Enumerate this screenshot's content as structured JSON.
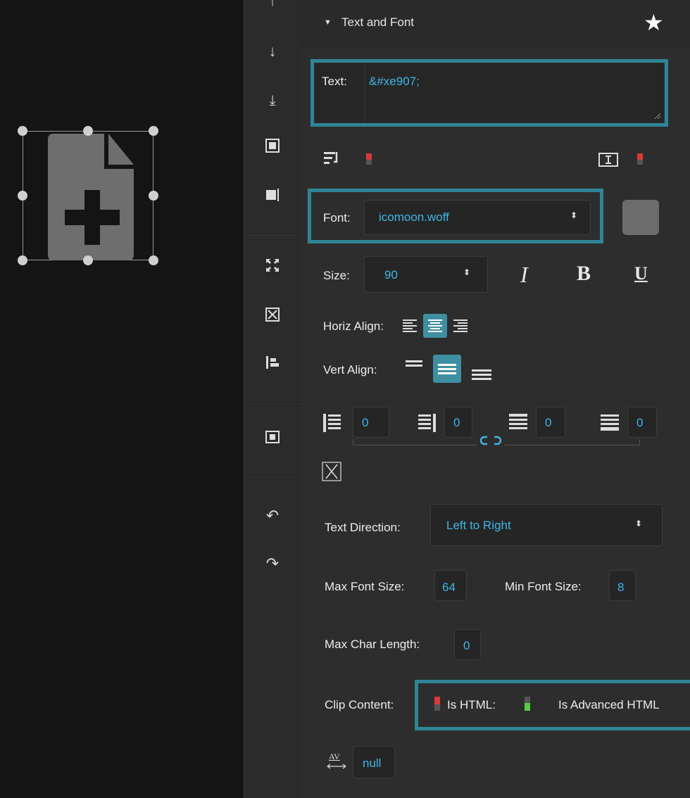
{
  "panel": {
    "section_title": "Text and Font",
    "text_label": "Text:",
    "text_value": "&#xe907;",
    "font_label": "Font:",
    "font_value": "icomoon.woff",
    "size_label": "Size:",
    "size_value": "90",
    "italic_label": "I",
    "bold_label": "B",
    "underline_label": "U",
    "horiz_align_label": "Horiz Align:",
    "vert_align_label": "Vert Align:",
    "padding_left": "0",
    "padding_right": "0",
    "padding_top": "0",
    "padding_bottom": "0",
    "text_direction_label": "Text Direction:",
    "text_direction_value": "Left to Right",
    "max_font_size_label": "Max Font Size:",
    "max_font_size_value": "64",
    "min_font_size_label": "Min Font Size:",
    "min_font_size_value": "8",
    "max_char_length_label": "Max Char Length:",
    "max_char_length_value": "0",
    "clip_content_label": "Clip Content:",
    "is_html_label": "Is HTML:",
    "is_advanced_html_label": "Is Advanced HTML",
    "letter_spacing_value": "null",
    "letter_spacing_icon_text": "AV"
  },
  "colors": {
    "accent": "#3fb6e6",
    "highlight": "#2f8496",
    "selected_button": "#3f8fa2",
    "toggle_off": "#d63a3a",
    "toggle_on": "#5cc84a"
  },
  "icons": [
    "arrow-down-icon",
    "send-to-back-icon",
    "frame-icon",
    "resize-icon",
    "expand-icon",
    "center-icon",
    "align-left-icon",
    "fit-icon",
    "undo-icon",
    "redo-icon",
    "star-icon",
    "word-wrap-icon",
    "text-cursor-icon",
    "link-icon",
    "close-x-icon",
    "letter-spacing-icon"
  ]
}
